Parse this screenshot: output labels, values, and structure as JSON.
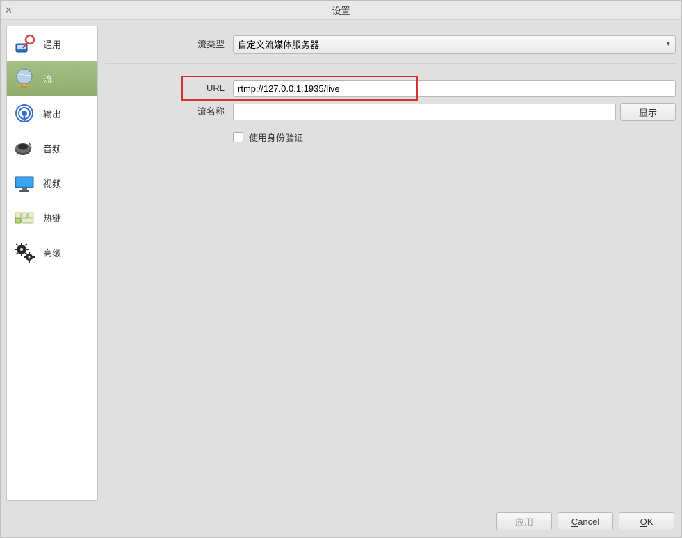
{
  "window": {
    "title": "设置"
  },
  "sidebar": {
    "items": [
      {
        "label": "通用"
      },
      {
        "label": "流"
      },
      {
        "label": "输出"
      },
      {
        "label": "音频"
      },
      {
        "label": "视频"
      },
      {
        "label": "热键"
      },
      {
        "label": "高级"
      }
    ],
    "selected_index": 1
  },
  "form": {
    "stream_type_label": "流类型",
    "stream_type_value": "自定义流媒体服务器",
    "url_label": "URL",
    "url_value": "rtmp://127.0.0.1:1935/live",
    "stream_key_label": "流名称",
    "stream_key_value": "",
    "show_button": "显示",
    "use_auth_label": "使用身份验证",
    "use_auth_checked": false
  },
  "buttons": {
    "apply": "应用",
    "cancel_prefix": "C",
    "cancel_rest": "ancel",
    "ok_prefix": "O",
    "ok_rest": "K"
  }
}
